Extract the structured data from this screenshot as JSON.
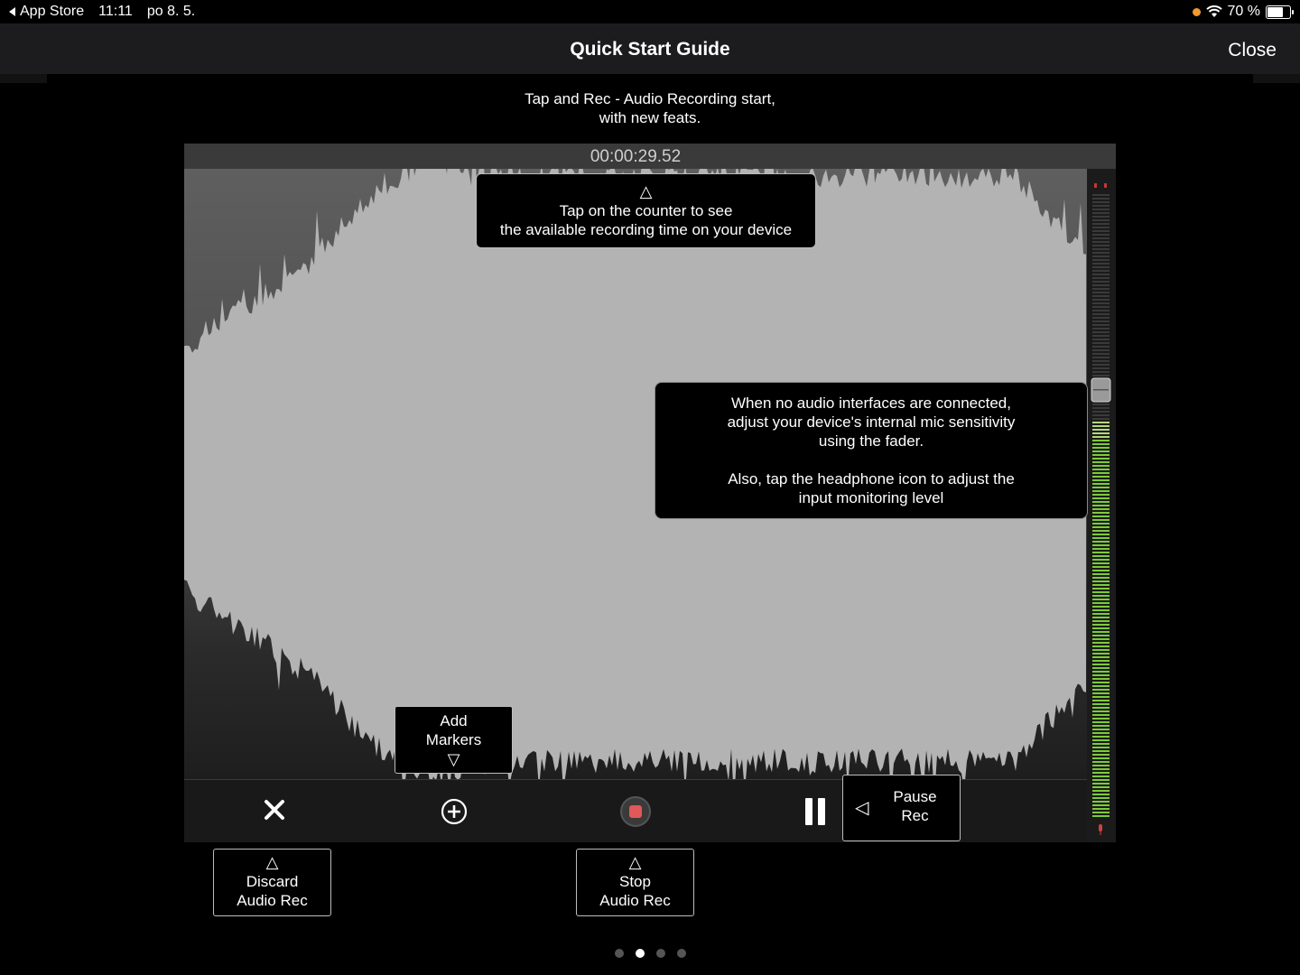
{
  "status_bar": {
    "back_label": "App Store",
    "time": "11:11",
    "date": "po 8. 5.",
    "battery": "70 %",
    "battery_level": 0.7,
    "icons": [
      "back-arrow-icon",
      "orange-dot-icon",
      "wifi-icon",
      "battery-icon"
    ]
  },
  "nav": {
    "title": "Quick Start Guide",
    "close_label": "Close"
  },
  "subtitle": {
    "line1": "Tap and Rec - Audio Recording start,",
    "line2": "with new feats."
  },
  "recorder": {
    "counter": "00:00:29.52",
    "waveform_color": "#b3b3b3",
    "stop_color": "#e05858",
    "meter_color": "#7ccb3a"
  },
  "callouts": {
    "counter": {
      "line1": "Tap on the counter to see",
      "line2": "the available recording time on your device"
    },
    "fader": {
      "line1": "When no audio interfaces are connected,",
      "line2": "adjust your device's internal mic sensitivity",
      "line3": "using the fader.",
      "line4": "Also, tap the headphone icon to adjust the",
      "line5": "input monitoring level"
    },
    "markers": {
      "line1": "Add",
      "line2": "Markers"
    },
    "pause": {
      "line1": "Pause",
      "line2": "Rec"
    },
    "discard": {
      "line1": "Discard",
      "line2": "Audio Rec"
    },
    "stop": {
      "line1": "Stop",
      "line2": "Audio Rec"
    }
  },
  "pager": {
    "count": 4,
    "active": 1
  }
}
